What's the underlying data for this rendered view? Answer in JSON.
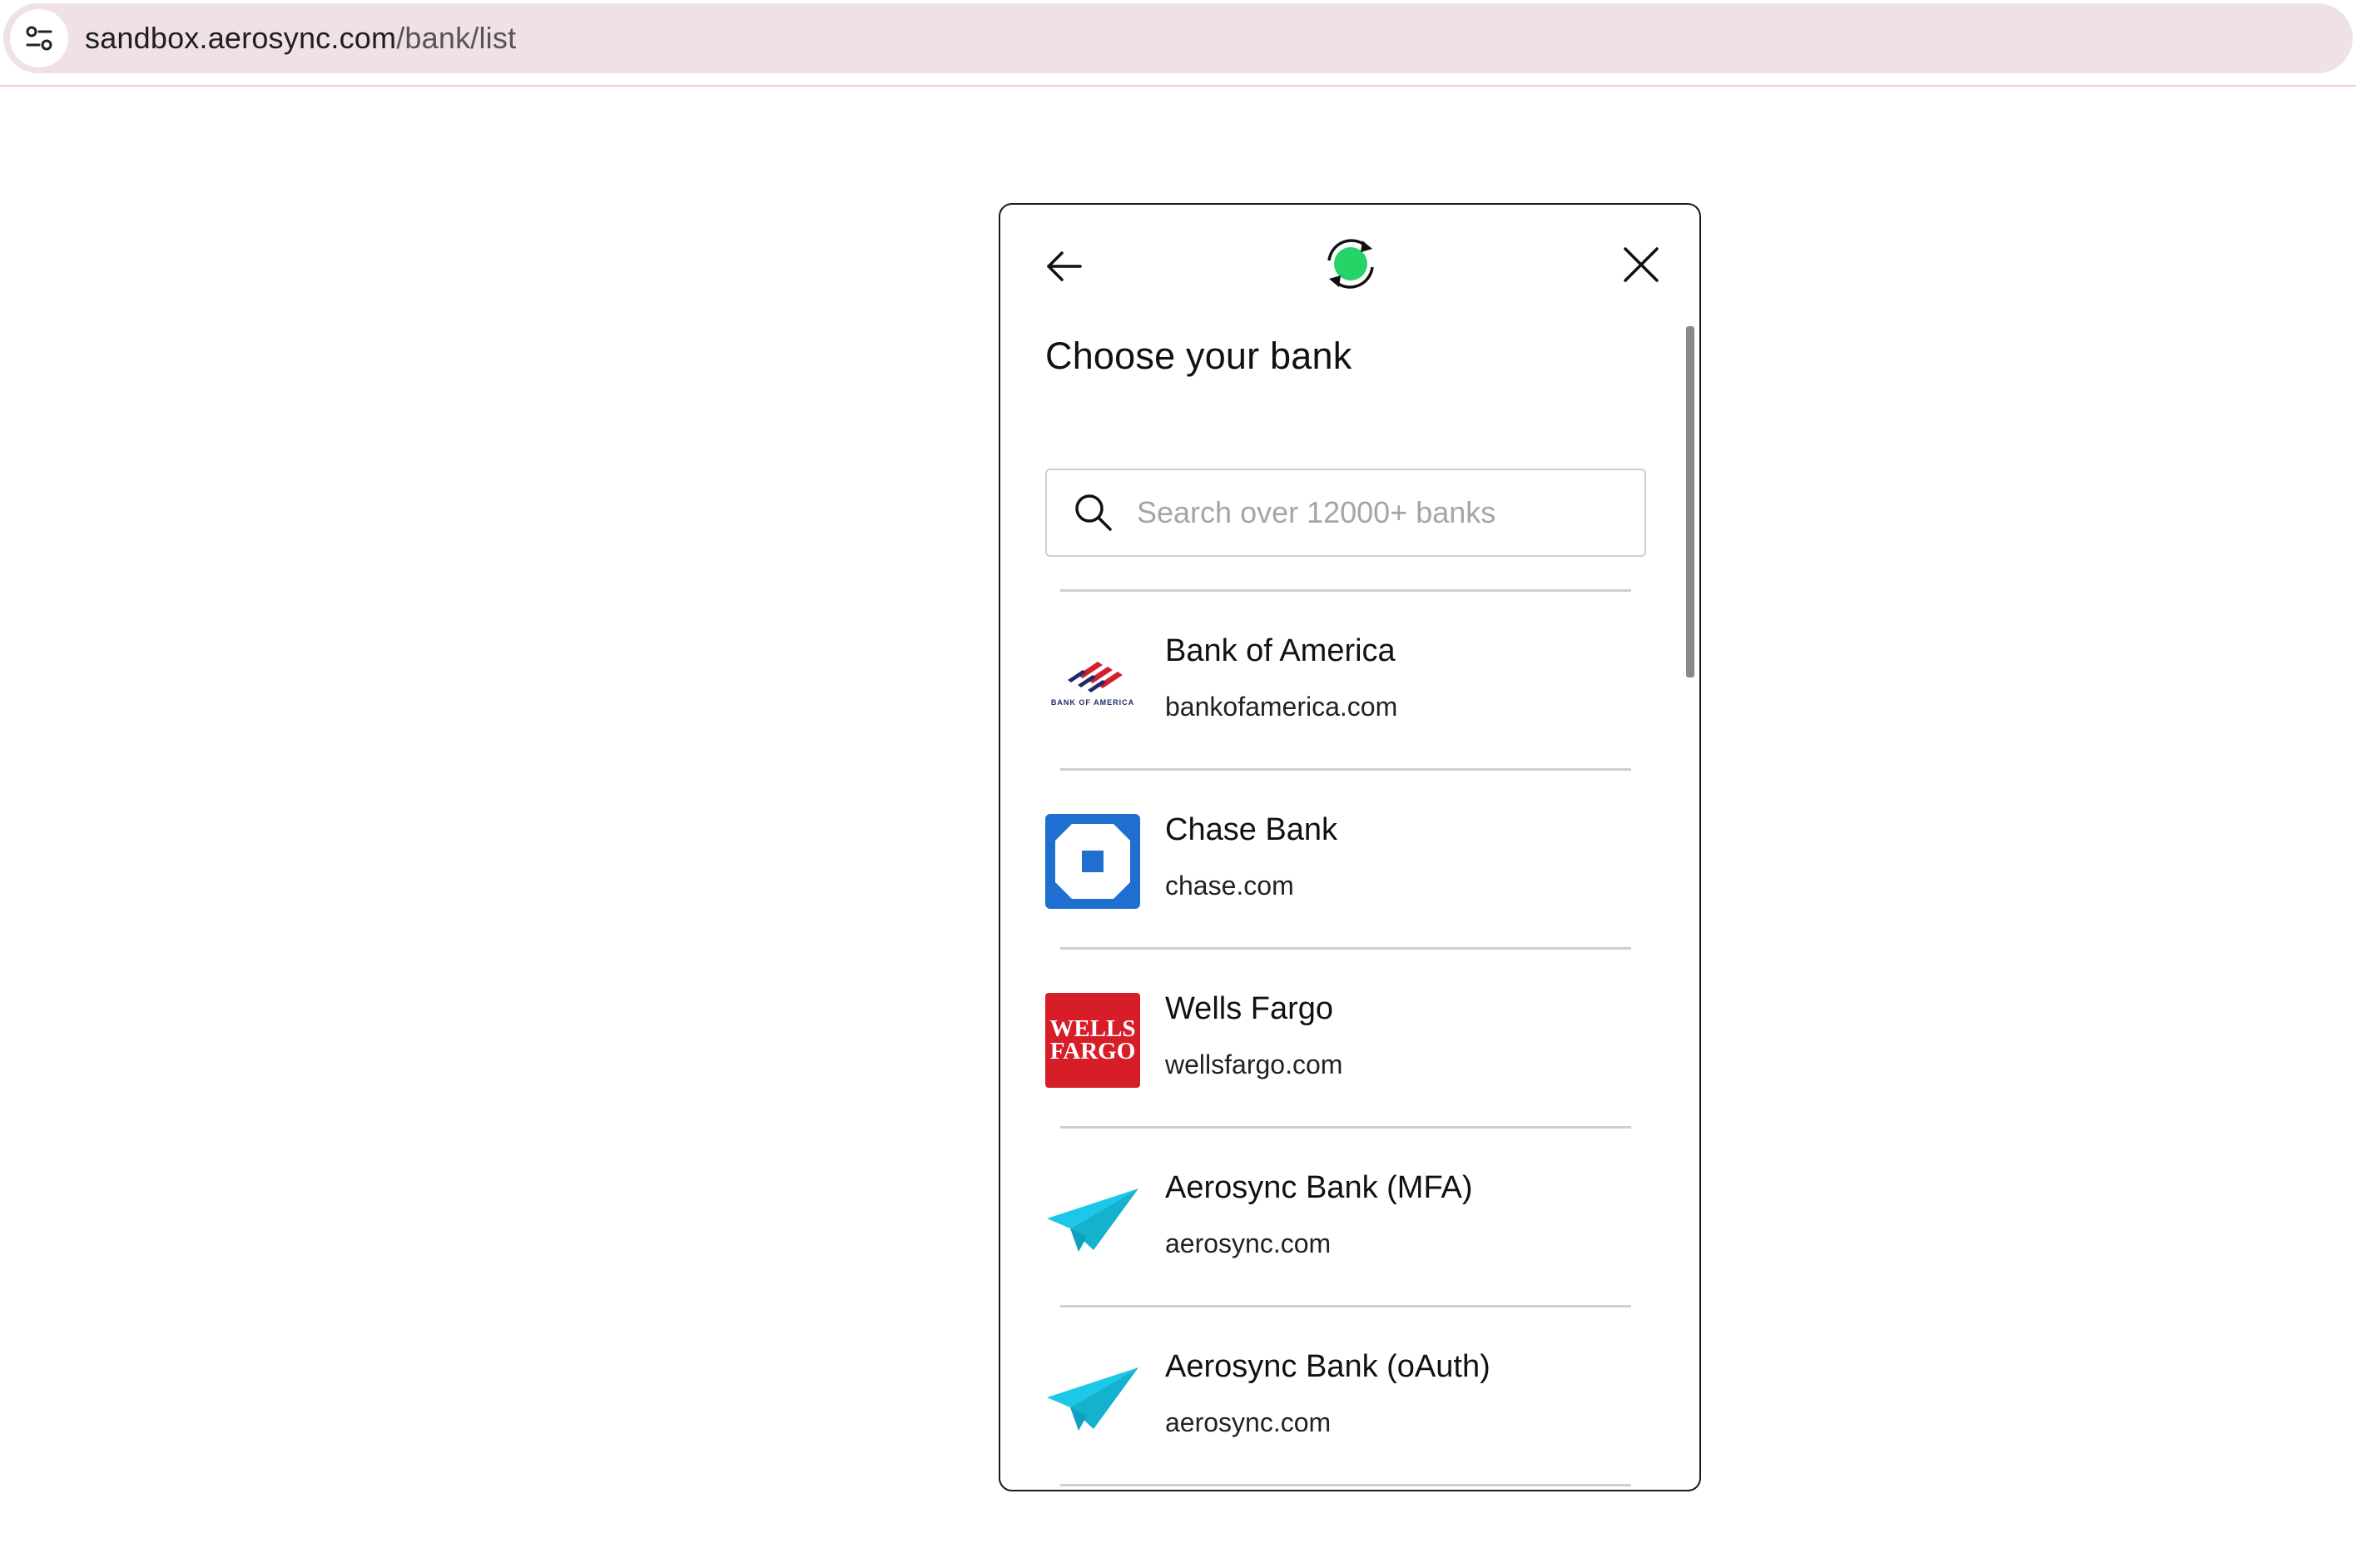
{
  "browser": {
    "url_host": "sandbox.aerosync.com",
    "url_path": "/bank/list"
  },
  "modal": {
    "title": "Choose your bank",
    "search": {
      "placeholder": "Search over 12000+ banks",
      "value": ""
    },
    "banks": [
      {
        "name": "Bank of America",
        "domain": "bankofamerica.com",
        "logo_text": "BANK OF AMERICA"
      },
      {
        "name": "Chase Bank",
        "domain": "chase.com"
      },
      {
        "name": "Wells Fargo",
        "domain": "wellsfargo.com",
        "logo_line1": "WELLS",
        "logo_line2": "FARGO"
      },
      {
        "name": "Aerosync Bank (MFA)",
        "domain": "aerosync.com"
      },
      {
        "name": "Aerosync Bank (oAuth)",
        "domain": "aerosync.com"
      }
    ]
  },
  "colors": {
    "brand_green": "#25d366",
    "chase_blue": "#1f6fd0",
    "wells_red": "#d71e28",
    "aerosync_cyan": "#1bc8e8",
    "boa_red": "#d4202c",
    "boa_navy": "#1f2a66"
  },
  "icons": {
    "site_settings": "tune-icon",
    "back": "arrow-left-icon",
    "logo": "sync-circle-icon",
    "close": "close-icon",
    "search": "search-icon",
    "aerosync": "paper-plane-icon"
  }
}
